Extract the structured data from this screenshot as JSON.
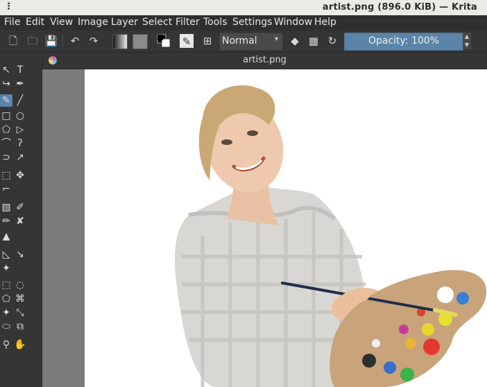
{
  "window": {
    "dots": "⋮",
    "title": "artist.png (896.0 KiB)  — Krita"
  },
  "menu": [
    {
      "label": "File"
    },
    {
      "label": "Edit"
    },
    {
      "label": "View"
    },
    {
      "label": "Image"
    },
    {
      "label": "Layer"
    },
    {
      "label": "Select"
    },
    {
      "label": "Filter"
    },
    {
      "label": "Tools"
    },
    {
      "label": "Settings"
    },
    {
      "label": "Window"
    },
    {
      "label": "Help"
    }
  ],
  "toolbar": {
    "icons": [
      "new-document-icon",
      "open-document-icon",
      "save-icon",
      "undo-icon",
      "redo-icon",
      "gradient-swatch-icon",
      "pattern-swatch-icon",
      "color-swap-icon",
      "brush-preset-icon",
      "brush-settings-icon",
      "eraser-icon",
      "alpha-lock-icon",
      "refresh-icon"
    ],
    "blend_mode": "Normal",
    "opacity_label": "Opacity: 100%"
  },
  "document_tab": {
    "label": "artist.png"
  },
  "toolbox": {
    "tools": [
      "select-shapes-icon",
      "text-icon",
      "edit-shapes-icon",
      "calligraphy-icon",
      "freehand-brush-icon",
      "line-icon",
      "rectangle-icon",
      "ellipse-icon",
      "polygon-icon",
      "polyline-icon",
      "bezier-icon",
      "freehand-path-icon",
      "dynamic-brush-icon",
      "multibrush-icon",
      "transform-icon",
      "move-icon",
      "crop-icon",
      "gradient-icon",
      "color-picker-icon",
      "colorize-mask-icon",
      "smart-patch-icon",
      "fill-icon",
      "assistant-icon",
      "measure-icon",
      "reference-icon",
      "rect-select-icon",
      "ellipse-select-icon",
      "polygon-select-icon",
      "freehand-select-icon",
      "contiguous-select-icon",
      "similar-select-icon",
      "bezier-select-icon",
      "magnetic-select-icon",
      "zoom-icon",
      "pan-icon"
    ],
    "active": "freehand-brush-icon"
  },
  "colors": {
    "accent": "#5a84a8",
    "panel": "#353535",
    "canvas_bg": "#7c7c7c"
  }
}
